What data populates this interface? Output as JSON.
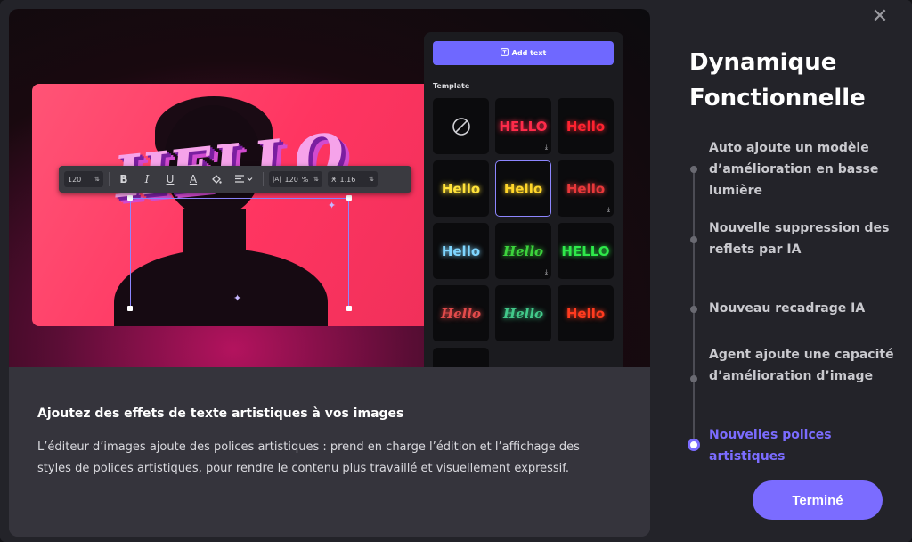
{
  "close_label": "✕",
  "title_line1": "Dynamique",
  "title_line2": "Fonctionnelle",
  "features": [
    "Auto ajoute un modèle d’amélioration en basse lumière",
    "Nouvelle suppression des reflets par IA",
    "Nouveau recadrage IA",
    "Agent ajoute une capacité d’amélioration d’image",
    "Nouvelles polices artistiques"
  ],
  "active_feature_index": 4,
  "done_button": "Terminé",
  "caption": {
    "title": "Ajoutez des effets de texte artistiques à vos images",
    "body": "L’éditeur d’images ajoute des polices artistiques : prend en charge l’édition et l’affichage des styles de polices artistiques, pour rendre le contenu plus travaillé et visuellement expressif."
  },
  "preview": {
    "hello_text": "HELLO",
    "toolbar": {
      "font_size": "120",
      "spacing": "120",
      "spacing_unit": "%",
      "line_height": "1.16"
    },
    "template_panel": {
      "add_text_label": "Add text",
      "template_label": "Template",
      "templates": [
        {
          "text": "",
          "icon": "none-icon",
          "color": "#cfcfd4"
        },
        {
          "text": "HELLO",
          "color": "#ff2b4a",
          "download": true
        },
        {
          "text": "Hello",
          "color": "#ff2330"
        },
        {
          "text": "Hello",
          "color": "#ffe23a"
        },
        {
          "text": "Hello",
          "color": "#ffd62a",
          "active": true
        },
        {
          "text": "Hello",
          "color": "#e8383a",
          "download": true
        },
        {
          "text": "Hello",
          "color": "#7fd6ff"
        },
        {
          "text": "Hello",
          "color": "#3cd33c",
          "download": true
        },
        {
          "text": "HELLO",
          "color": "#2ee94a"
        },
        {
          "text": "Hello",
          "color": "#e34b4b"
        },
        {
          "text": "Hello",
          "color": "#42c98a"
        },
        {
          "text": "Hello",
          "color": "#ff3b1f"
        }
      ]
    }
  },
  "colors": {
    "accent": "#7b6cff",
    "panel_bg": "#232329",
    "card_bg": "#35343c"
  }
}
